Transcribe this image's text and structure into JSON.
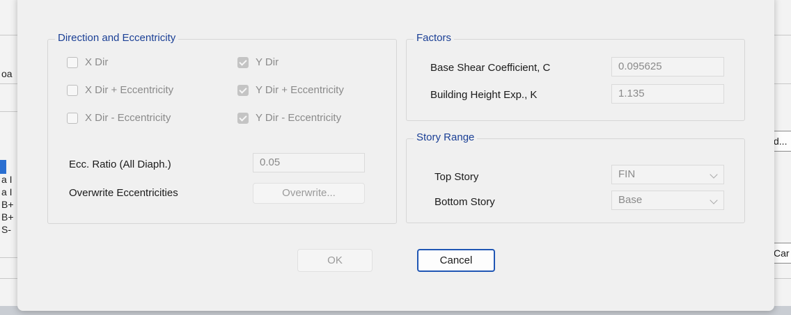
{
  "background": {
    "left_fragments": [
      "oa",
      "ʼ",
      "ʼ",
      "a I",
      "a I",
      "B+",
      "B+",
      "S-"
    ],
    "right_buttons": [
      "d...",
      "Car"
    ]
  },
  "direction_group": {
    "title": "Direction and Eccentricity",
    "checkboxes": [
      {
        "label": "X Dir",
        "checked": false
      },
      {
        "label": "Y Dir",
        "checked": true
      },
      {
        "label": "X Dir + Eccentricity",
        "checked": false
      },
      {
        "label": "Y Dir + Eccentricity",
        "checked": true
      },
      {
        "label": "X Dir - Eccentricity",
        "checked": false
      },
      {
        "label": "Y Dir - Eccentricity",
        "checked": true
      }
    ],
    "ecc_ratio_label": "Ecc. Ratio (All Diaph.)",
    "ecc_ratio_value": "0.05",
    "overwrite_label": "Overwrite Eccentricities",
    "overwrite_button": "Overwrite..."
  },
  "factors_group": {
    "title": "Factors",
    "base_shear_label": "Base Shear Coefficient, C",
    "base_shear_value": "0.095625",
    "height_exp_label": "Building Height Exp., K",
    "height_exp_value": "1.135"
  },
  "story_group": {
    "title": "Story Range",
    "top_label": "Top Story",
    "top_value": "FIN",
    "bottom_label": "Bottom Story",
    "bottom_value": "Base"
  },
  "buttons": {
    "ok": "OK",
    "cancel": "Cancel"
  }
}
